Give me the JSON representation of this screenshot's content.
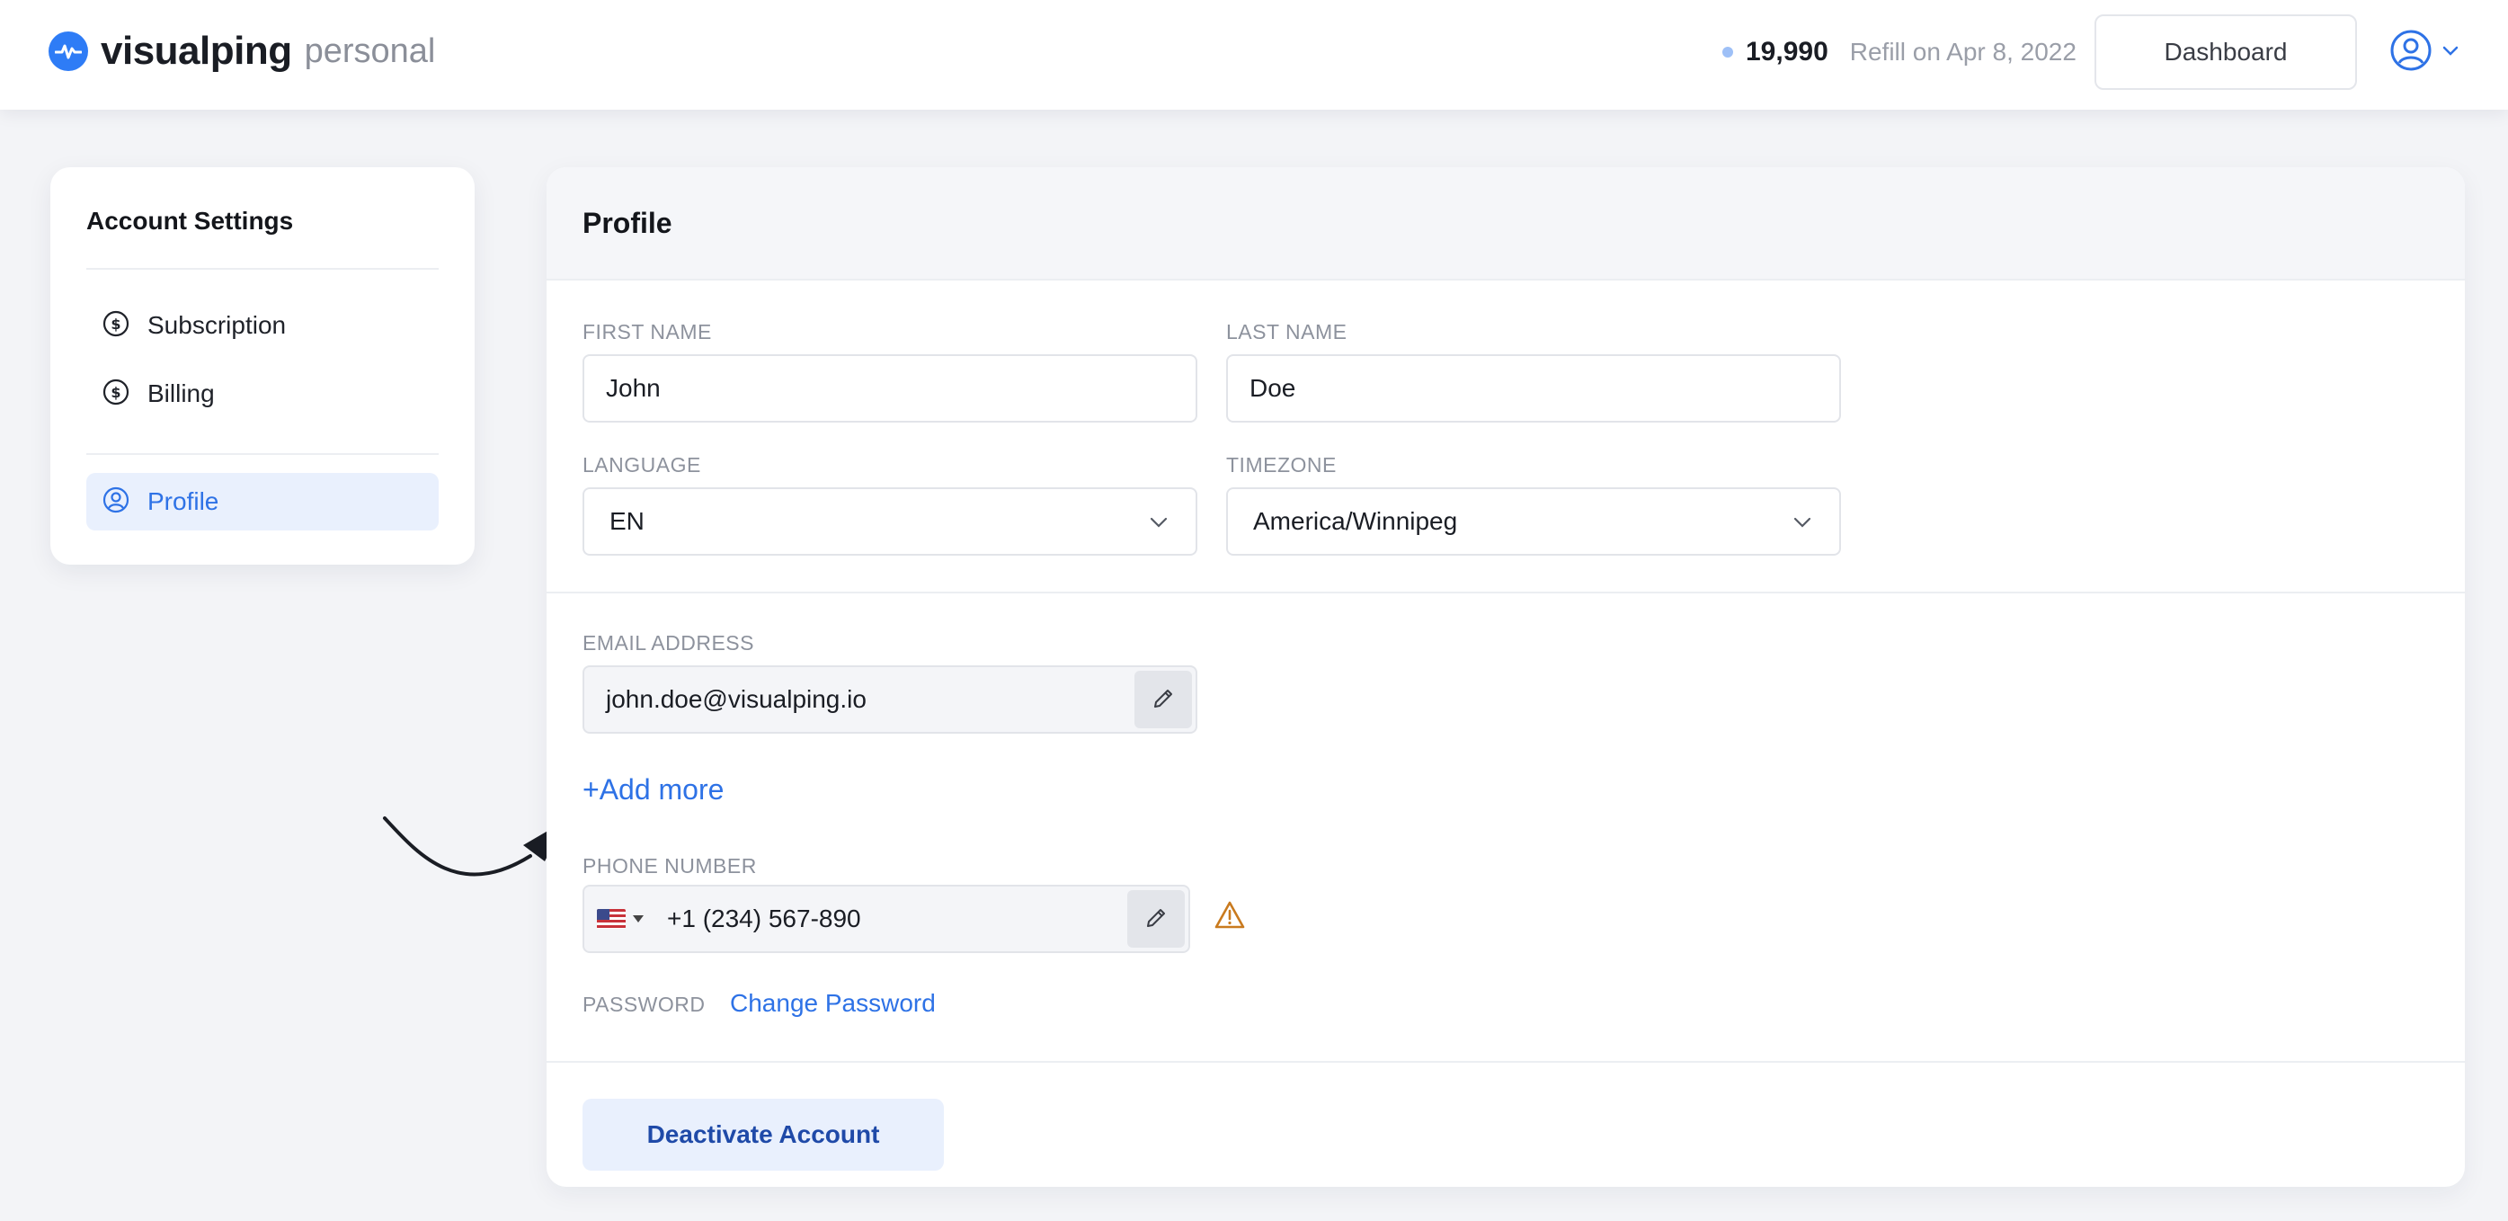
{
  "header": {
    "brand_name": "visualping",
    "brand_plan": "personal",
    "credits": "19,990",
    "refill": "Refill on Apr 8, 2022",
    "dashboard_label": "Dashboard"
  },
  "sidebar": {
    "title": "Account Settings",
    "items": [
      {
        "label": "Subscription",
        "icon": "dollar-circle-icon"
      },
      {
        "label": "Billing",
        "icon": "dollar-circle-icon"
      },
      {
        "label": "Profile",
        "icon": "user-circle-icon",
        "active": true
      }
    ]
  },
  "profile": {
    "title": "Profile",
    "first_name_label": "FIRST NAME",
    "first_name": "John",
    "last_name_label": "LAST NAME",
    "last_name": "Doe",
    "language_label": "LANGUAGE",
    "language": "EN",
    "timezone_label": "TIMEZONE",
    "timezone": "America/Winnipeg",
    "email_label": "EMAIL ADDRESS",
    "email": "john.doe@visualping.io",
    "add_more": "+Add more",
    "phone_label": "PHONE NUMBER",
    "phone": "+1 (234) 567-890",
    "password_label": "PASSWORD",
    "change_password": "Change Password",
    "deactivate": "Deactivate Account"
  },
  "colors": {
    "accent": "#2e72e6",
    "warning": "#c97a1e"
  }
}
